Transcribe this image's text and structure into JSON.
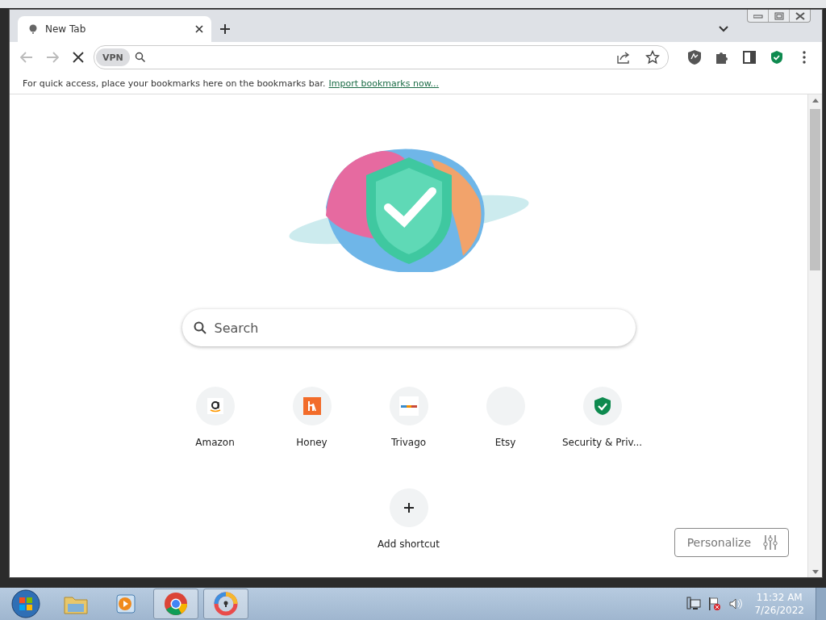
{
  "browser": {
    "tabs": [
      {
        "title": "New Tab",
        "selected": true
      }
    ],
    "toolbar": {
      "back_disabled": true,
      "forward_disabled": true,
      "vpn_badge": "VPN"
    },
    "bookmarks_bar": {
      "message": "For quick access, place your bookmarks here on the bookmarks bar.",
      "link": "Import bookmarks now..."
    },
    "new_tab_page": {
      "search": {
        "placeholder": "Search"
      },
      "shortcuts": [
        {
          "label": "Amazon",
          "kind": "amazon"
        },
        {
          "label": "Honey",
          "kind": "honey"
        },
        {
          "label": "Trivago",
          "kind": "trivago"
        },
        {
          "label": "Etsy",
          "kind": "blank"
        },
        {
          "label": "Security & Priv...",
          "kind": "shield"
        }
      ],
      "add_shortcut": "Add shortcut",
      "personalize": "Personalize"
    }
  },
  "taskbar": {
    "apps": [
      {
        "kind": "start",
        "active": false
      },
      {
        "kind": "explorer",
        "active": false
      },
      {
        "kind": "media",
        "active": false
      },
      {
        "kind": "chrome",
        "active": true
      },
      {
        "kind": "vpn",
        "active": true
      }
    ],
    "clock": {
      "time": "11:32 AM",
      "date": "7/26/2022"
    }
  }
}
